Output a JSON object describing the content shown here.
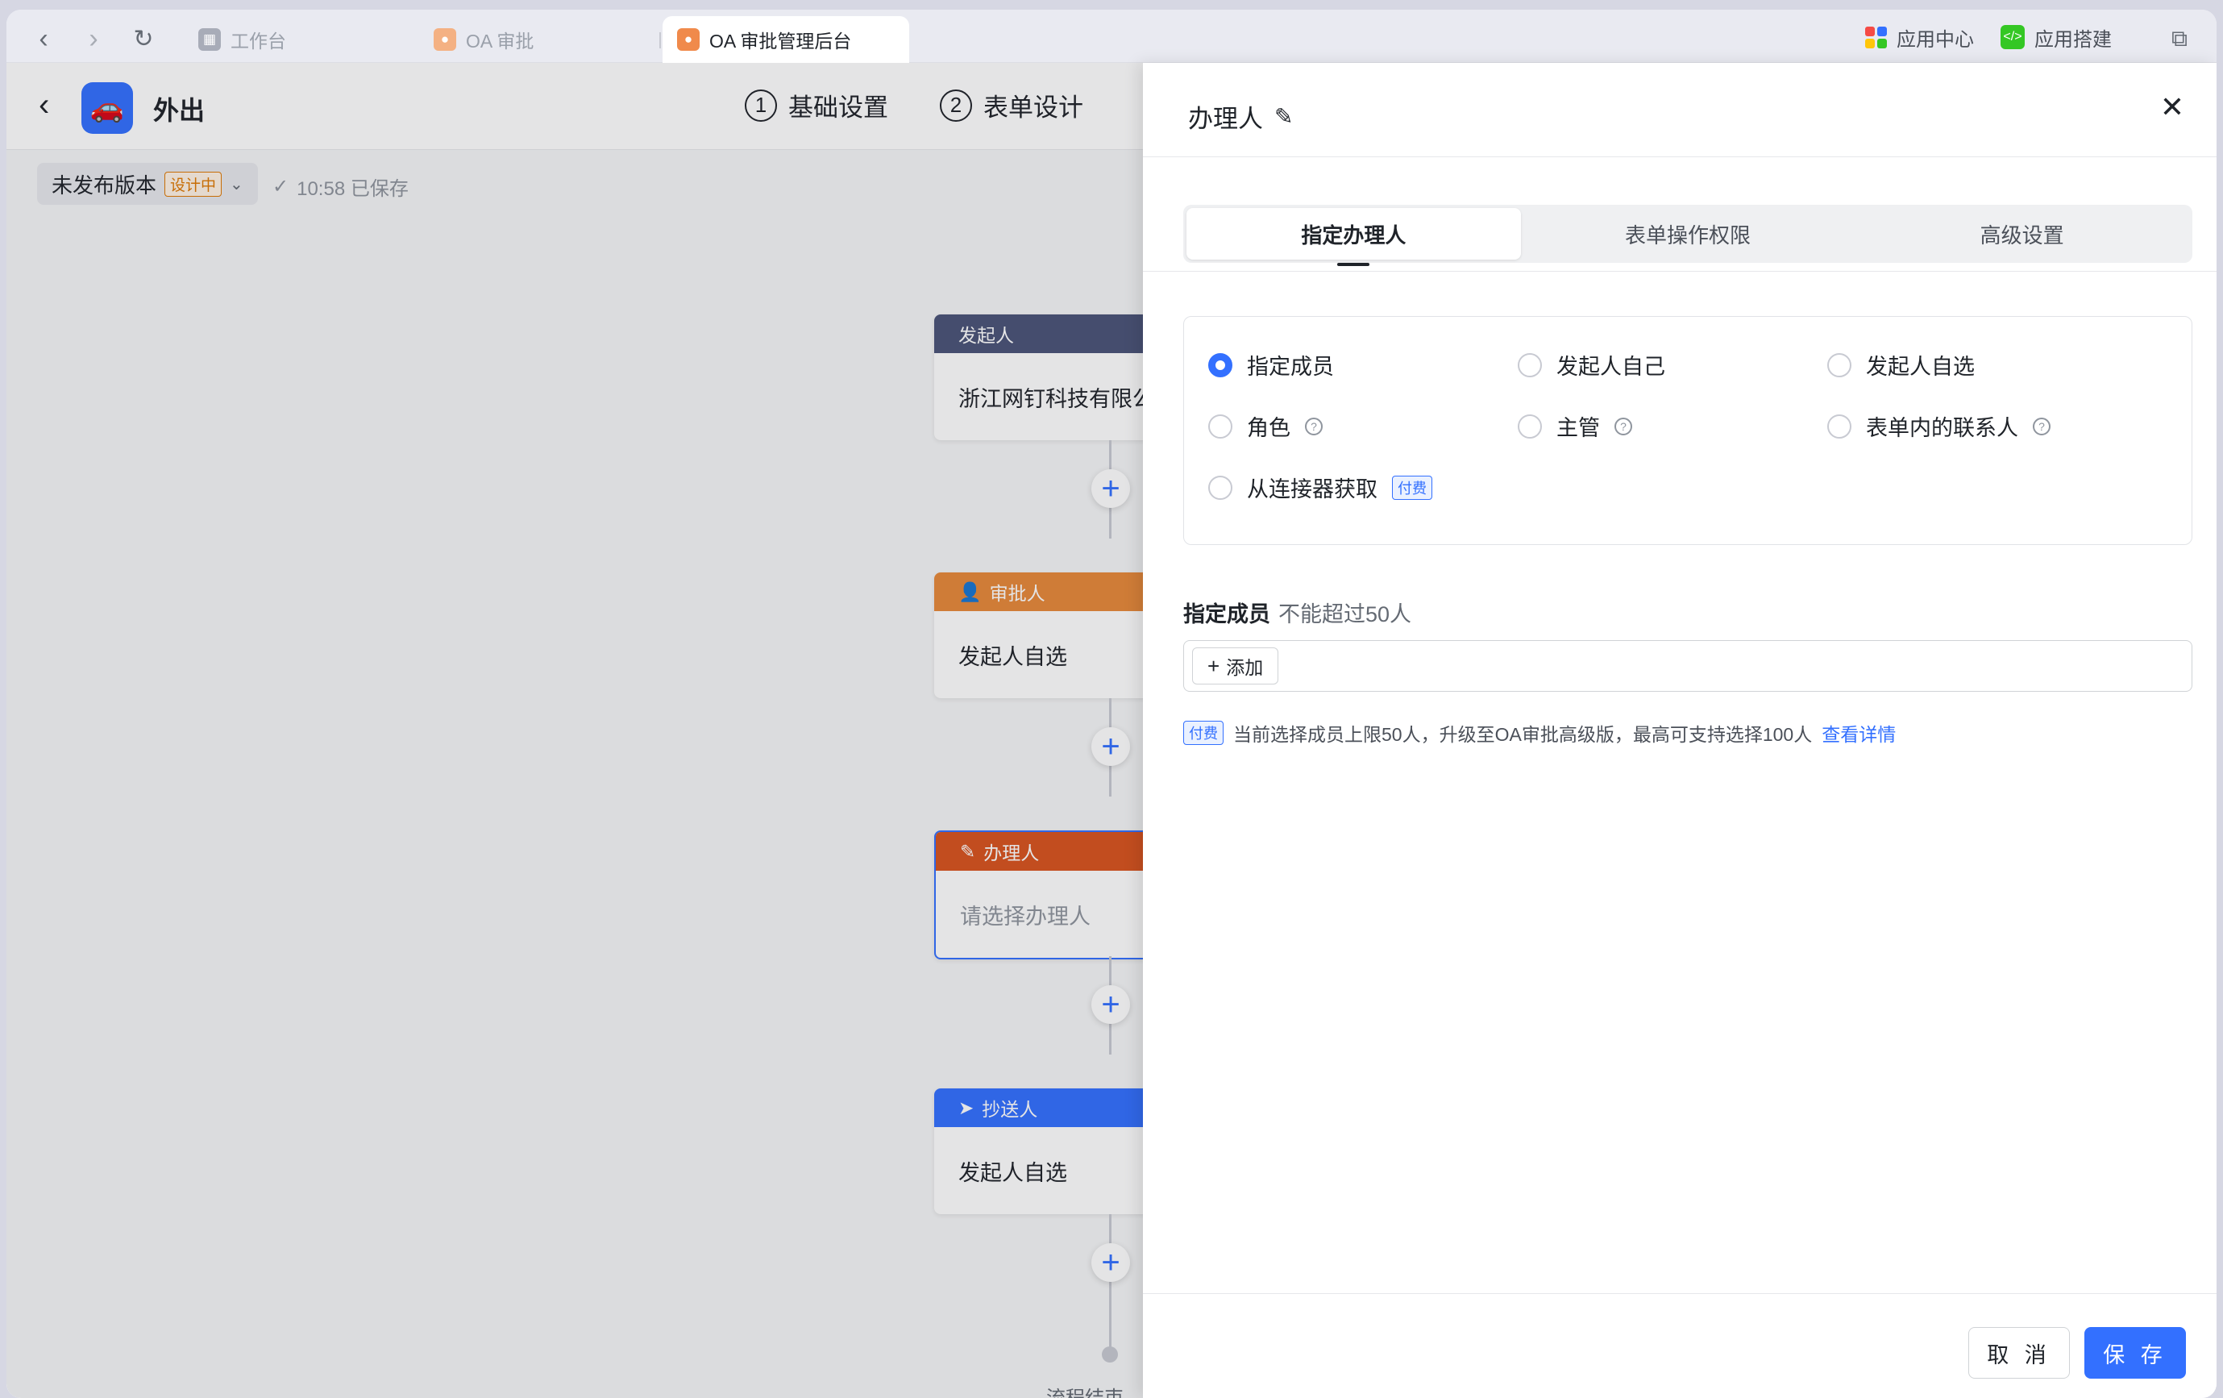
{
  "tabs": [
    {
      "label": "工作台",
      "active": false
    },
    {
      "label": "OA 审批",
      "active": false
    },
    {
      "label": "OA 审批管理后台",
      "active": true
    }
  ],
  "topbar": {
    "app_center": "应用中心",
    "app_build": "应用搭建"
  },
  "page": {
    "title": "外出",
    "steps": [
      {
        "num": "1",
        "label": "基础设置"
      },
      {
        "num": "2",
        "label": "表单设计"
      }
    ],
    "version": "未发布版本",
    "version_badge": "设计中",
    "save_status": "10:58 已保存"
  },
  "flow": {
    "nodes": [
      {
        "header": "发起人",
        "body": "浙江网钉科技有限公",
        "color": "#4a5478"
      },
      {
        "header": "审批人",
        "body": "发起人自选",
        "color": "#e8893a"
      },
      {
        "header": "办理人",
        "body": "请选择办理人",
        "color": "#d9541e"
      },
      {
        "header": "抄送人",
        "body": "发起人自选",
        "color": "#3370ff"
      }
    ],
    "end_label": "流程结束"
  },
  "drawer": {
    "title": "办理人",
    "tabs": [
      "指定办理人",
      "表单操作权限",
      "高级设置"
    ],
    "options": {
      "row1": [
        "指定成员",
        "发起人自己",
        "发起人自选"
      ],
      "row2": [
        "角色",
        "主管",
        "表单内的联系人"
      ],
      "row3": [
        "从连接器获取"
      ]
    },
    "pay_badge": "付费",
    "section_title": "指定成员",
    "section_hint": "不能超过50人",
    "add_label": "添加",
    "notice_text": "当前选择成员上限50人，升级至OA审批高级版，最高可支持选择100人",
    "notice_link": "查看详情",
    "cancel": "取 消",
    "save": "保 存"
  }
}
